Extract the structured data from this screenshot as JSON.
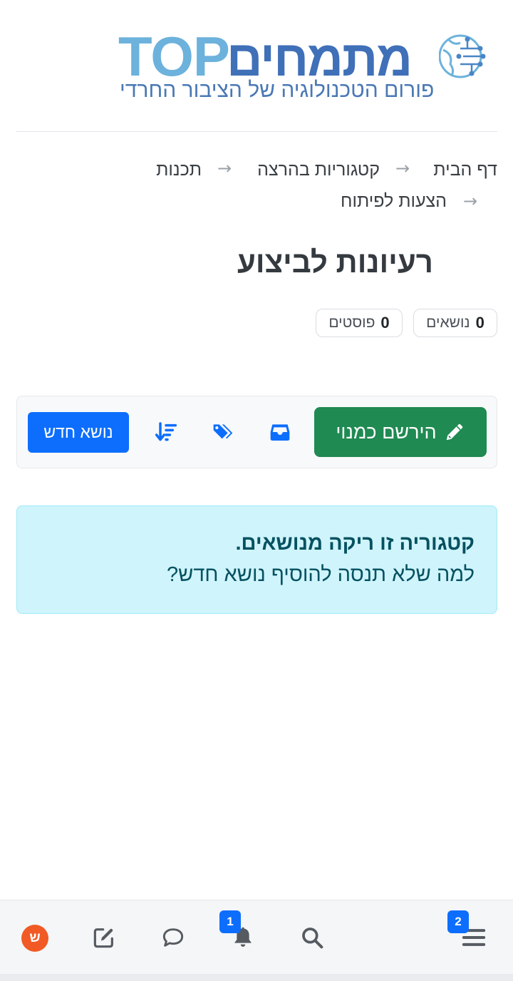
{
  "logo": {
    "brand_latin": "TOP",
    "brand_hebrew": "מתמחים",
    "tagline": "פורום הטכנולוגיה של הציבור החרדי",
    "emblem_icon": "globe-circuit-icon"
  },
  "breadcrumbs": [
    {
      "label": "דף הבית"
    },
    {
      "label": "קטגוריות בהרצה"
    },
    {
      "label": "תכנות"
    },
    {
      "label": "הצעות לפיתוח"
    }
  ],
  "breadcrumb_separator": "→",
  "page": {
    "title": "רעיונות לביצוע",
    "stats": {
      "topics_count": "0",
      "topics_label": "נושאים",
      "posts_count": "0",
      "posts_label": "פוסטים"
    }
  },
  "toolbar": {
    "register_label": "הירשם כמנוי",
    "register_icon": "pencil-icon",
    "watch_icon": "inbox-icon",
    "tags_icon": "tags-icon",
    "sort_icon": "sort-icon",
    "new_topic_label": "נושא חדש"
  },
  "empty_state": {
    "title": "קטגוריה זו ריקה מנושאים.",
    "text": "למה שלא תנסה להוסיף נושא חדש?"
  },
  "bottom_nav": {
    "menu_badge": "2",
    "notifications_badge": "1",
    "avatar_letter": "ש",
    "icons": [
      "menu-icon",
      "search-icon",
      "bell-icon",
      "chat-icon",
      "compose-icon",
      "avatar"
    ]
  },
  "colors": {
    "primary": "#0d6efd",
    "success": "#1f8a52",
    "info_bg": "#cff4fc",
    "info_text": "#055160",
    "avatar_bg": "#f15a24",
    "logo_light": "#6cb2dc",
    "logo_dark": "#3f70b8"
  }
}
